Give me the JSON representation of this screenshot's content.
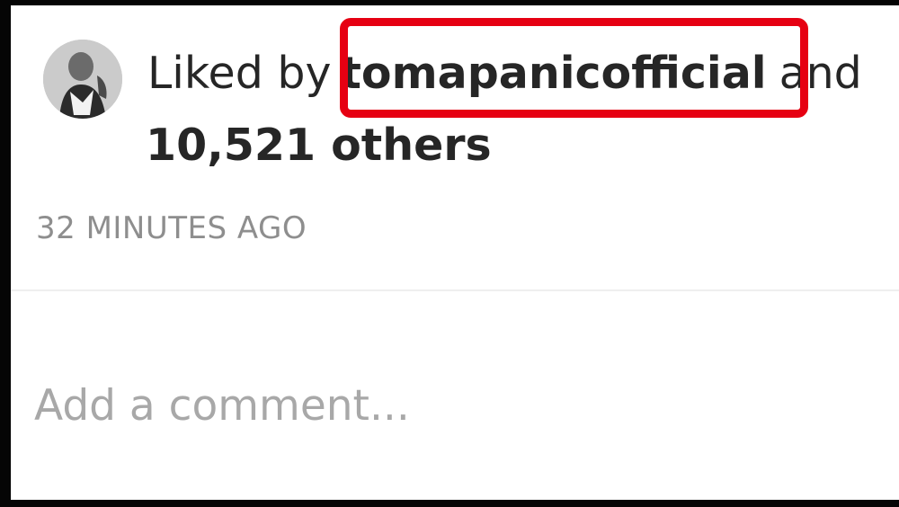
{
  "likes": {
    "prefix": "Liked by",
    "username": "tomapanicofficial",
    "connector": "and",
    "others": "10,521 others",
    "avatar_icon": "user-avatar-photo"
  },
  "post": {
    "timestamp": "32 MINUTES AGO"
  },
  "comment": {
    "placeholder": "Add a comment..."
  },
  "annotation": {
    "highlight_color": "#e60012"
  }
}
